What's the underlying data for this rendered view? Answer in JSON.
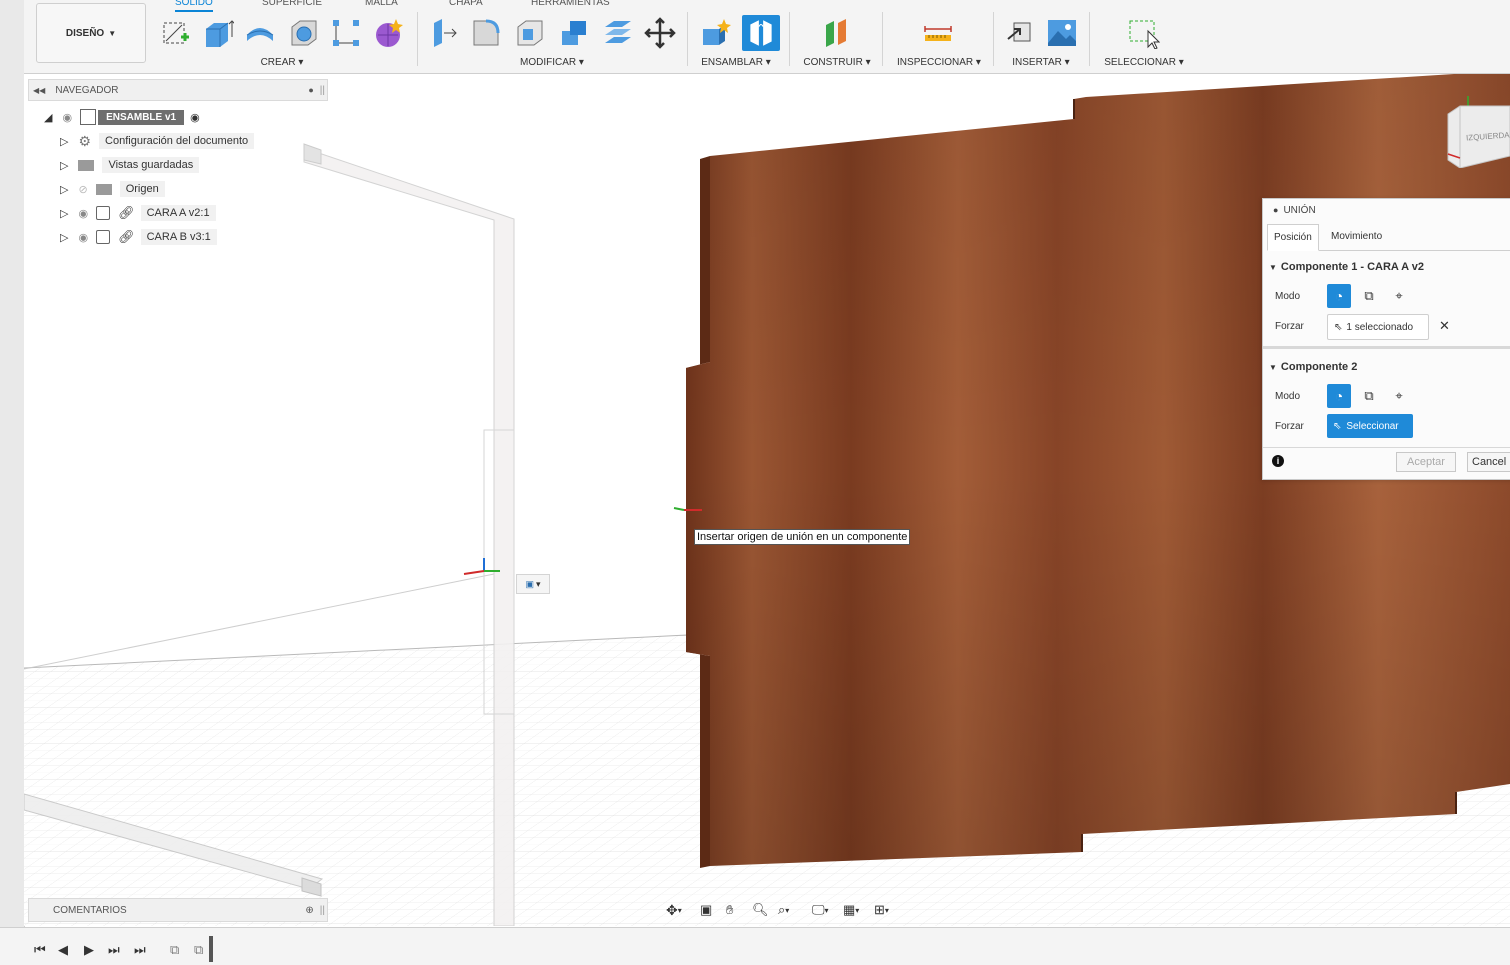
{
  "workspace": {
    "label": "DISEÑO"
  },
  "tabs": [
    {
      "label": "SÓLIDO",
      "active": true
    },
    {
      "label": "SUPERFICIE"
    },
    {
      "label": "MALLA"
    },
    {
      "label": "CHAPA"
    },
    {
      "label": "HERRAMIENTAS"
    }
  ],
  "groups": {
    "crear": "CREAR",
    "modificar": "MODIFICAR",
    "ensamblar": "ENSAMBLAR",
    "construir": "CONSTRUIR",
    "inspeccionar": "INSPECCIONAR",
    "insertar": "INSERTAR",
    "seleccionar": "SELECCIONAR"
  },
  "browser": {
    "title": "NAVEGADOR",
    "root": "ENSAMBLE v1",
    "items": [
      {
        "label": "Configuración del documento",
        "icon": "gear-icon"
      },
      {
        "label": "Vistas guardadas",
        "icon": "folder-icon"
      },
      {
        "label": "Origen",
        "icon": "folder-icon"
      },
      {
        "label": "CARA A v2:1",
        "icon": "component-icon"
      },
      {
        "label": "CARA B v3:1",
        "icon": "component-icon"
      }
    ]
  },
  "comments": {
    "title": "COMENTARIOS"
  },
  "tooltip": "Insertar origen de unión en un componente",
  "joint_dialog": {
    "title": "UNIÓN",
    "tabs": [
      "Posición",
      "Movimiento"
    ],
    "component1": {
      "title": "Componente 1 - CARA A v2",
      "mode_label": "Modo",
      "snap_label": "Forzar",
      "snap_value": "1 seleccionado"
    },
    "component2": {
      "title": "Componente 2",
      "mode_label": "Modo",
      "snap_label": "Forzar",
      "snap_value": "Seleccionar"
    },
    "ok_label": "Aceptar",
    "cancel_label": "Cancel"
  },
  "viewcube": {
    "label": "IZQUIERDA"
  },
  "colors": {
    "accent": "#1f8ad8",
    "wood": "#8e4a2c",
    "toolbar_bg": "#f4f4f4"
  }
}
